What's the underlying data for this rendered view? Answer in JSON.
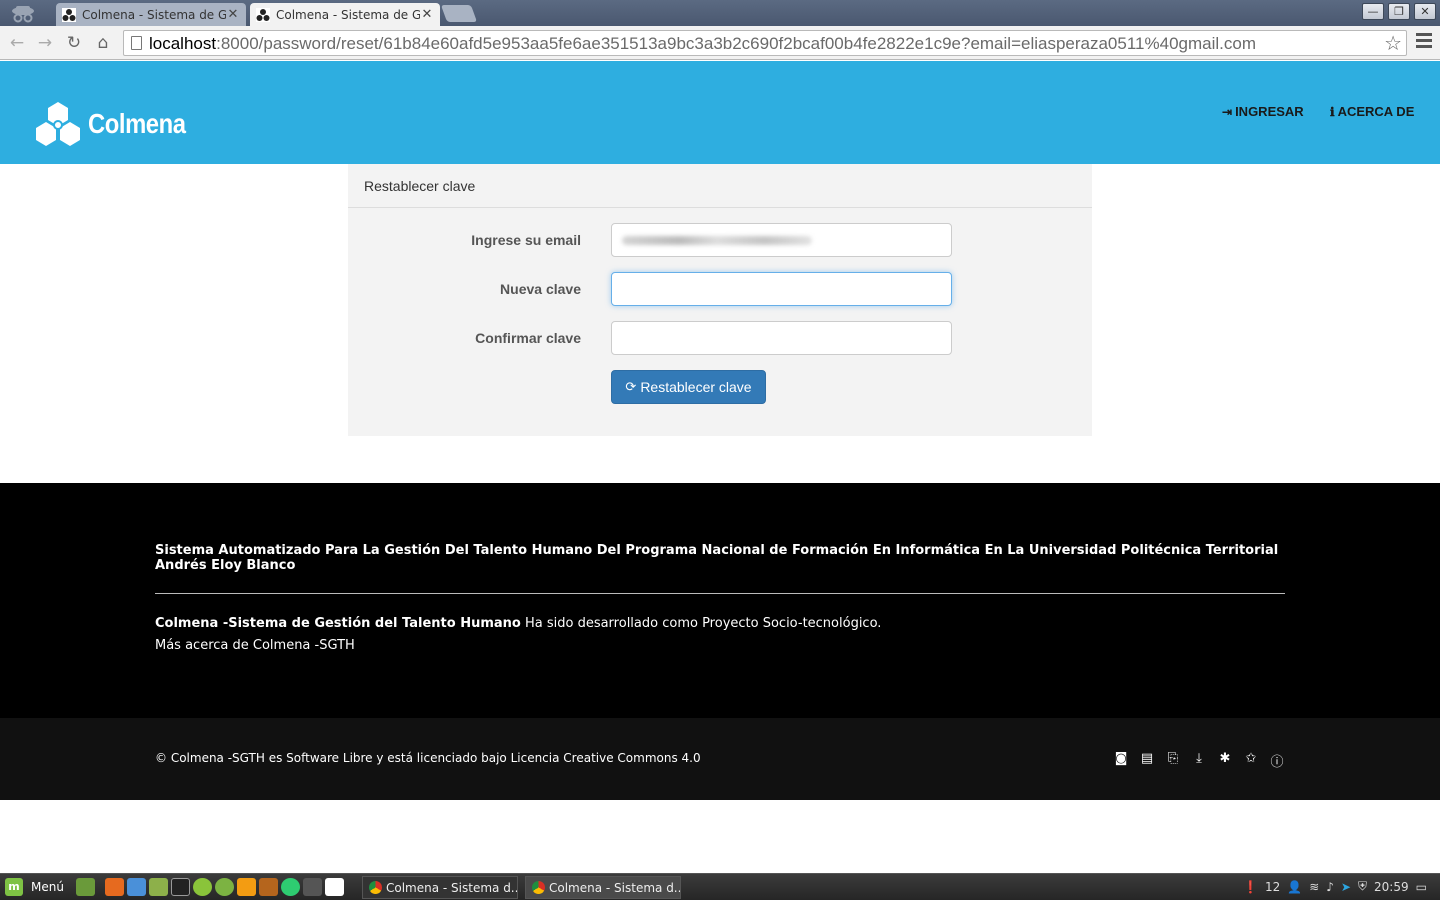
{
  "browser": {
    "tabs": [
      {
        "title": "Colmena - Sistema de Ge",
        "active": false
      },
      {
        "title": "Colmena - Sistema de Ge",
        "active": true
      }
    ],
    "url_host": "localhost",
    "url_rest": ":8000/password/reset/61b84e60afd5e953aa5fe6ae351513a9bc3a3b2c690f2bcaf00b4fe2822e1c9e?email=eliasperaza0511%40gmail.com",
    "window_controls": {
      "minimize": "—",
      "restore": "❐",
      "close": "✕"
    }
  },
  "app": {
    "brand": "Colmena",
    "nav": [
      {
        "icon": "sign-in-icon",
        "glyph": "⇥",
        "label": "INGRESAR"
      },
      {
        "icon": "info-icon",
        "glyph": "ℹ",
        "label": "ACERCA DE"
      }
    ],
    "colors": {
      "header": "#2eaee0",
      "primary_button": "#337ab7",
      "footer": "#000000"
    }
  },
  "form": {
    "title": "Restablecer clave",
    "fields": [
      {
        "label": "Ingrese su email",
        "value": "",
        "blurred": true
      },
      {
        "label": "Nueva clave",
        "value": "",
        "focused": true
      },
      {
        "label": "Confirmar clave",
        "value": ""
      }
    ],
    "submit_label": "Restablecer clave"
  },
  "footer": {
    "title": "Sistema Automatizado Para La Gestión Del Talento Humano Del Programa Nacional de Formación En Informática En La Universidad Politécnica Territorial Andrés Eloy Blanco",
    "project_bold": "Colmena -Sistema de Gestión del Talento Humano",
    "project_text": " Ha sido desarrollado como Proyecto Socio-tecnológico.",
    "more_link": "Más acerca de Colmena -SGTH",
    "license": "Colmena -SGTH es Software Libre y está licenciado bajo Licencia Creative Commons 4.0",
    "license_glyph": "©",
    "icons": [
      "github-icon",
      "document-icon",
      "pdf-icon",
      "download-icon",
      "bug-icon",
      "star-icon",
      "info-icon"
    ]
  },
  "taskbar": {
    "menu_label": "Menú",
    "windows": [
      {
        "label": "Colmena - Sistema d...",
        "active": false
      },
      {
        "label": "Colmena - Sistema d...",
        "active": true
      }
    ],
    "tray_count": "12",
    "clock": "20:59"
  }
}
